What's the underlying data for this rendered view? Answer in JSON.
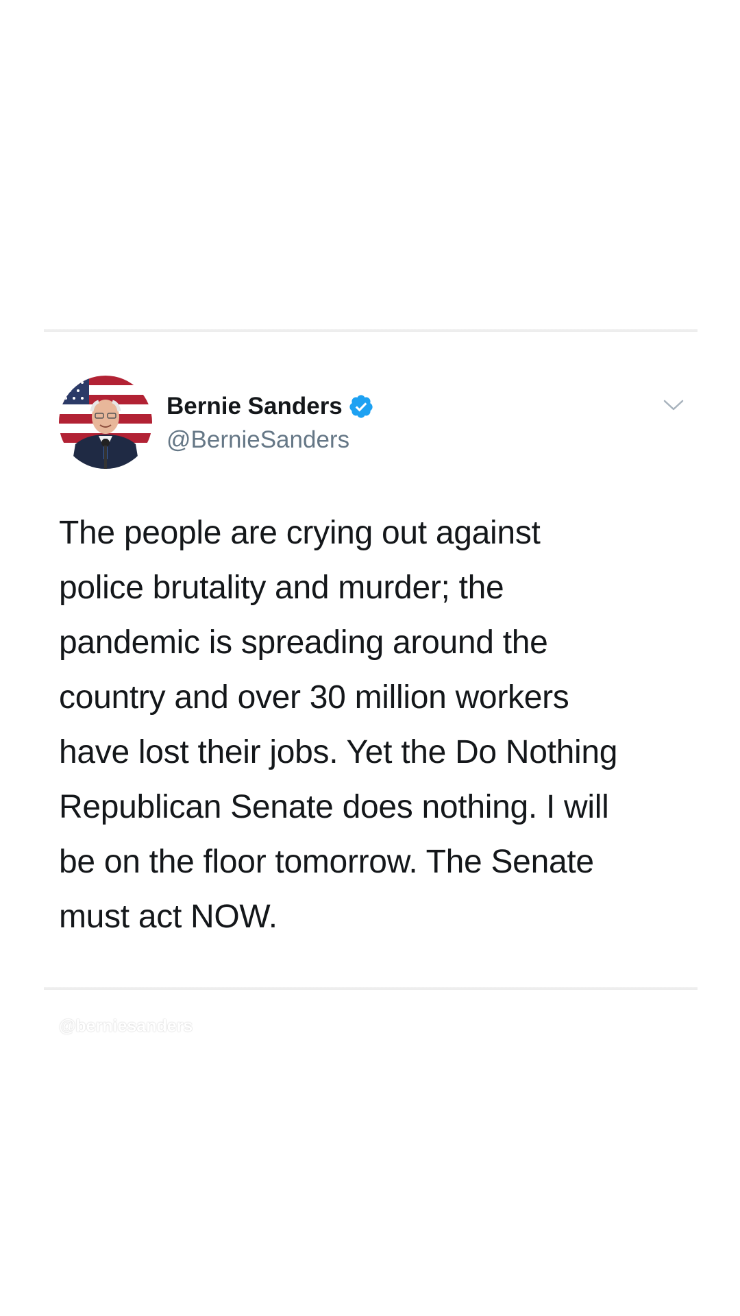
{
  "tweet": {
    "display_name": "Bernie Sanders",
    "handle": "@BernieSanders",
    "verified": true,
    "text": "The people are crying out against\npolice brutality and murder; the\npandemic is spreading around the\ncountry and over 30 million workers\nhave lost their jobs. Yet the Do Nothing\nRepublican Senate does nothing. I will\nbe on the floor tomorrow. The Senate\nmust act NOW."
  },
  "watermark": "@berniesanders",
  "icons": {
    "verified": "verified-badge-icon",
    "menu": "chevron-down-icon"
  },
  "colors": {
    "verified_blue": "#1da1f2",
    "handle_gray": "#657786",
    "text": "#14171a"
  }
}
